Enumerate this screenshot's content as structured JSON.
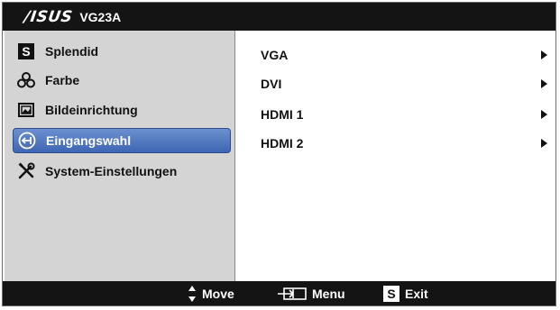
{
  "header": {
    "brand": "/ISUS",
    "model": "VG23A"
  },
  "menu": {
    "items": [
      {
        "label": "Splendid",
        "icon": "splendid-s-icon",
        "active": false
      },
      {
        "label": "Farbe",
        "icon": "color-circles-icon",
        "active": false
      },
      {
        "label": "Bildeinrichtung",
        "icon": "image-icon",
        "active": false
      },
      {
        "label": "Eingangswahl",
        "icon": "input-select-icon",
        "active": true
      },
      {
        "label": "System-Einstellungen",
        "icon": "tools-icon",
        "active": false
      }
    ]
  },
  "sources": {
    "items": [
      {
        "label": "VGA"
      },
      {
        "label": "DVI"
      },
      {
        "label": "HDMI 1"
      },
      {
        "label": "HDMI 2"
      }
    ]
  },
  "footer": {
    "move": "Move",
    "menu": "Menu",
    "exit": "Exit"
  },
  "colors": {
    "header_bg": "#141414",
    "panel_bg": "#d4d4d4",
    "active_bg": "#4a72bd",
    "text": "#111111"
  }
}
